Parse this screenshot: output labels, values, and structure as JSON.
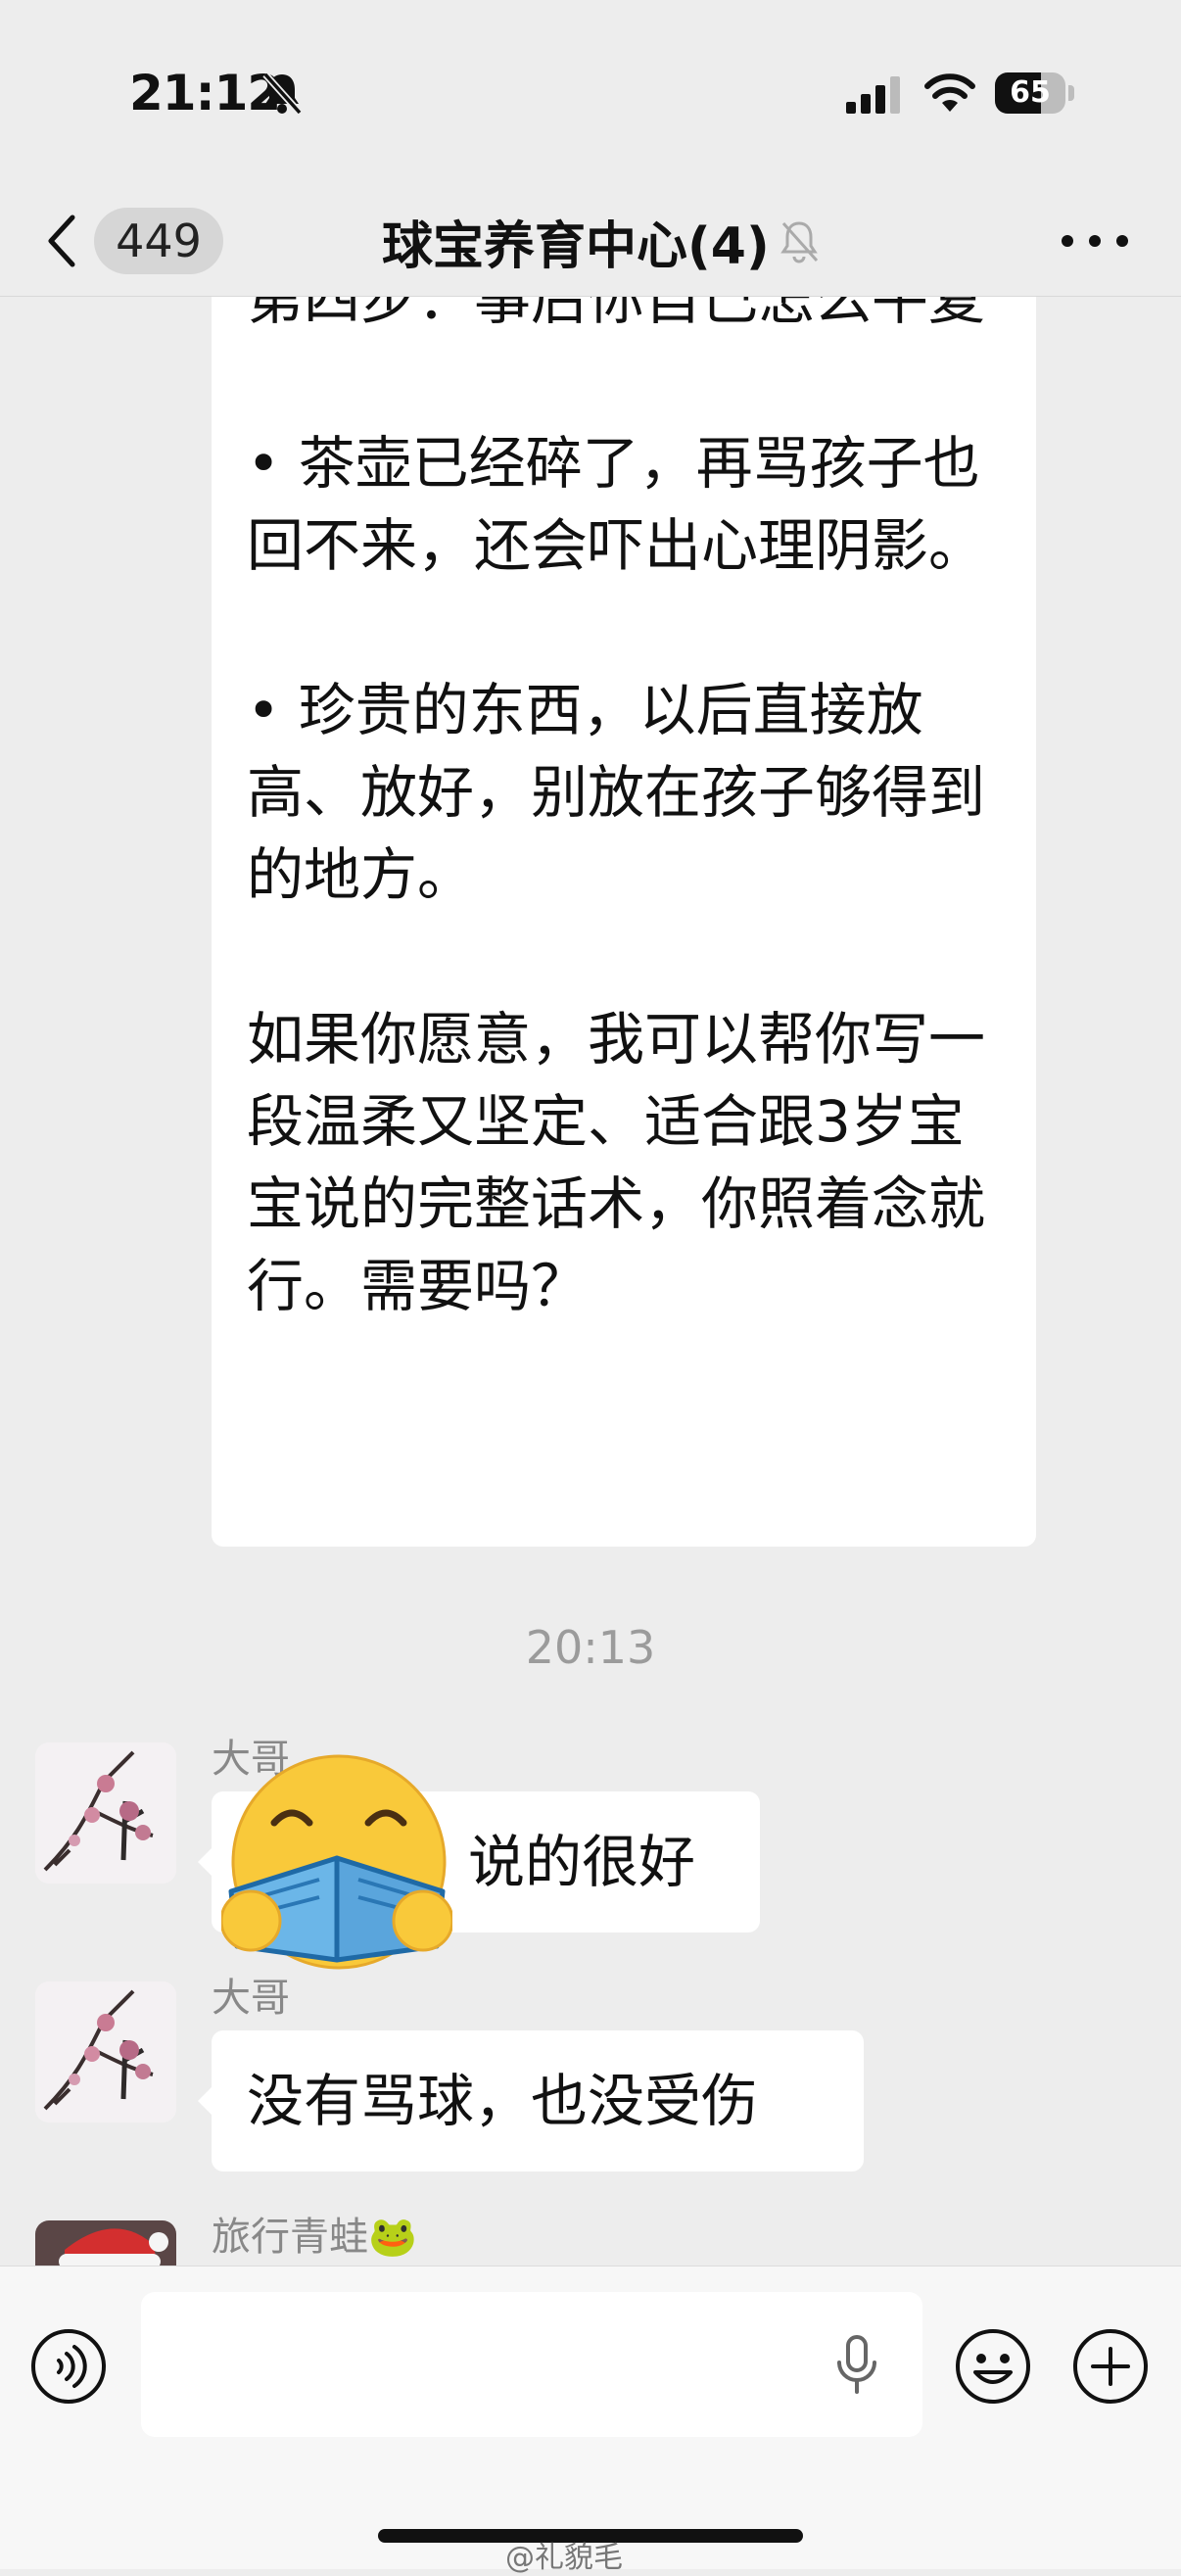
{
  "status_bar": {
    "time": "21:12",
    "battery": "65",
    "battery_level": 0.65
  },
  "nav": {
    "unread_count": "449",
    "title": "球宝养育中心(4)"
  },
  "messages": {
    "long_text_paragraphs": [
      "第四步：事后你自己怎么平复",
      "• 茶壶已经碎了，再骂孩子也回不来，还会吓出心理阴影。",
      "• 珍贵的东西，以后直接放高、放好，别放在孩子够得到的地方。",
      "如果你愿意，我可以帮你写一段温柔又坚定、适合跟3岁宝宝说的完整话术，你照着念就行。需要吗？"
    ],
    "timestamp": "20:13",
    "items": [
      {
        "sender": "大哥",
        "text": "说的很好"
      },
      {
        "sender": "大哥",
        "text": "没有骂球，也没受伤"
      },
      {
        "sender": "旅行青蛙🐸"
      }
    ]
  },
  "watermark": "@礼貌毛",
  "colors": {
    "background": "#ededed",
    "bubble": "#ffffff",
    "timestamp": "#9b9b9b",
    "sender": "#888888"
  }
}
